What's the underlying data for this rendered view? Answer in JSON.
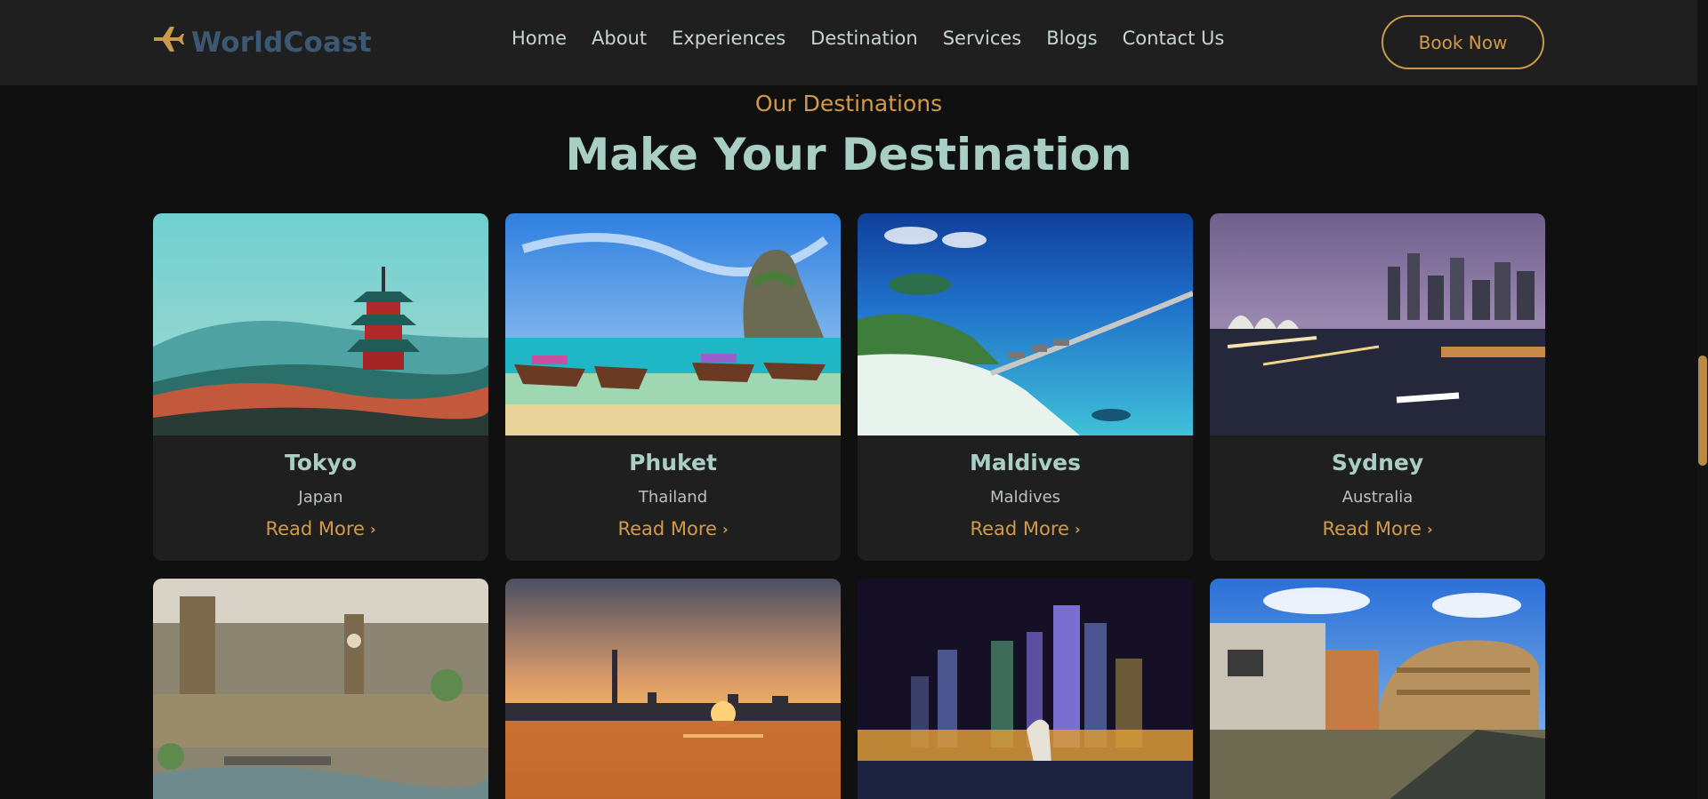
{
  "header": {
    "logo_text": "WorldCoast",
    "logo_icon": "airplane-icon",
    "nav": [
      "Home",
      "About",
      "Experiences",
      "Destination",
      "Services",
      "Blogs",
      "Contact Us"
    ],
    "book_label": "Book Now"
  },
  "section": {
    "kicker": "Our Destinations",
    "title": "Make Your Destination"
  },
  "destinations": [
    {
      "name": "Tokyo",
      "country": "Japan",
      "more": "Read More"
    },
    {
      "name": "Phuket",
      "country": "Thailand",
      "more": "Read More"
    },
    {
      "name": "Maldives",
      "country": "Maldives",
      "more": "Read More"
    },
    {
      "name": "Sydney",
      "country": "Australia",
      "more": "Read More"
    }
  ],
  "colors": {
    "accent": "#d19b4a",
    "heading": "#a9cfc4",
    "background": "#101010",
    "card": "#1f1f1f",
    "logo": "#3d5872"
  }
}
